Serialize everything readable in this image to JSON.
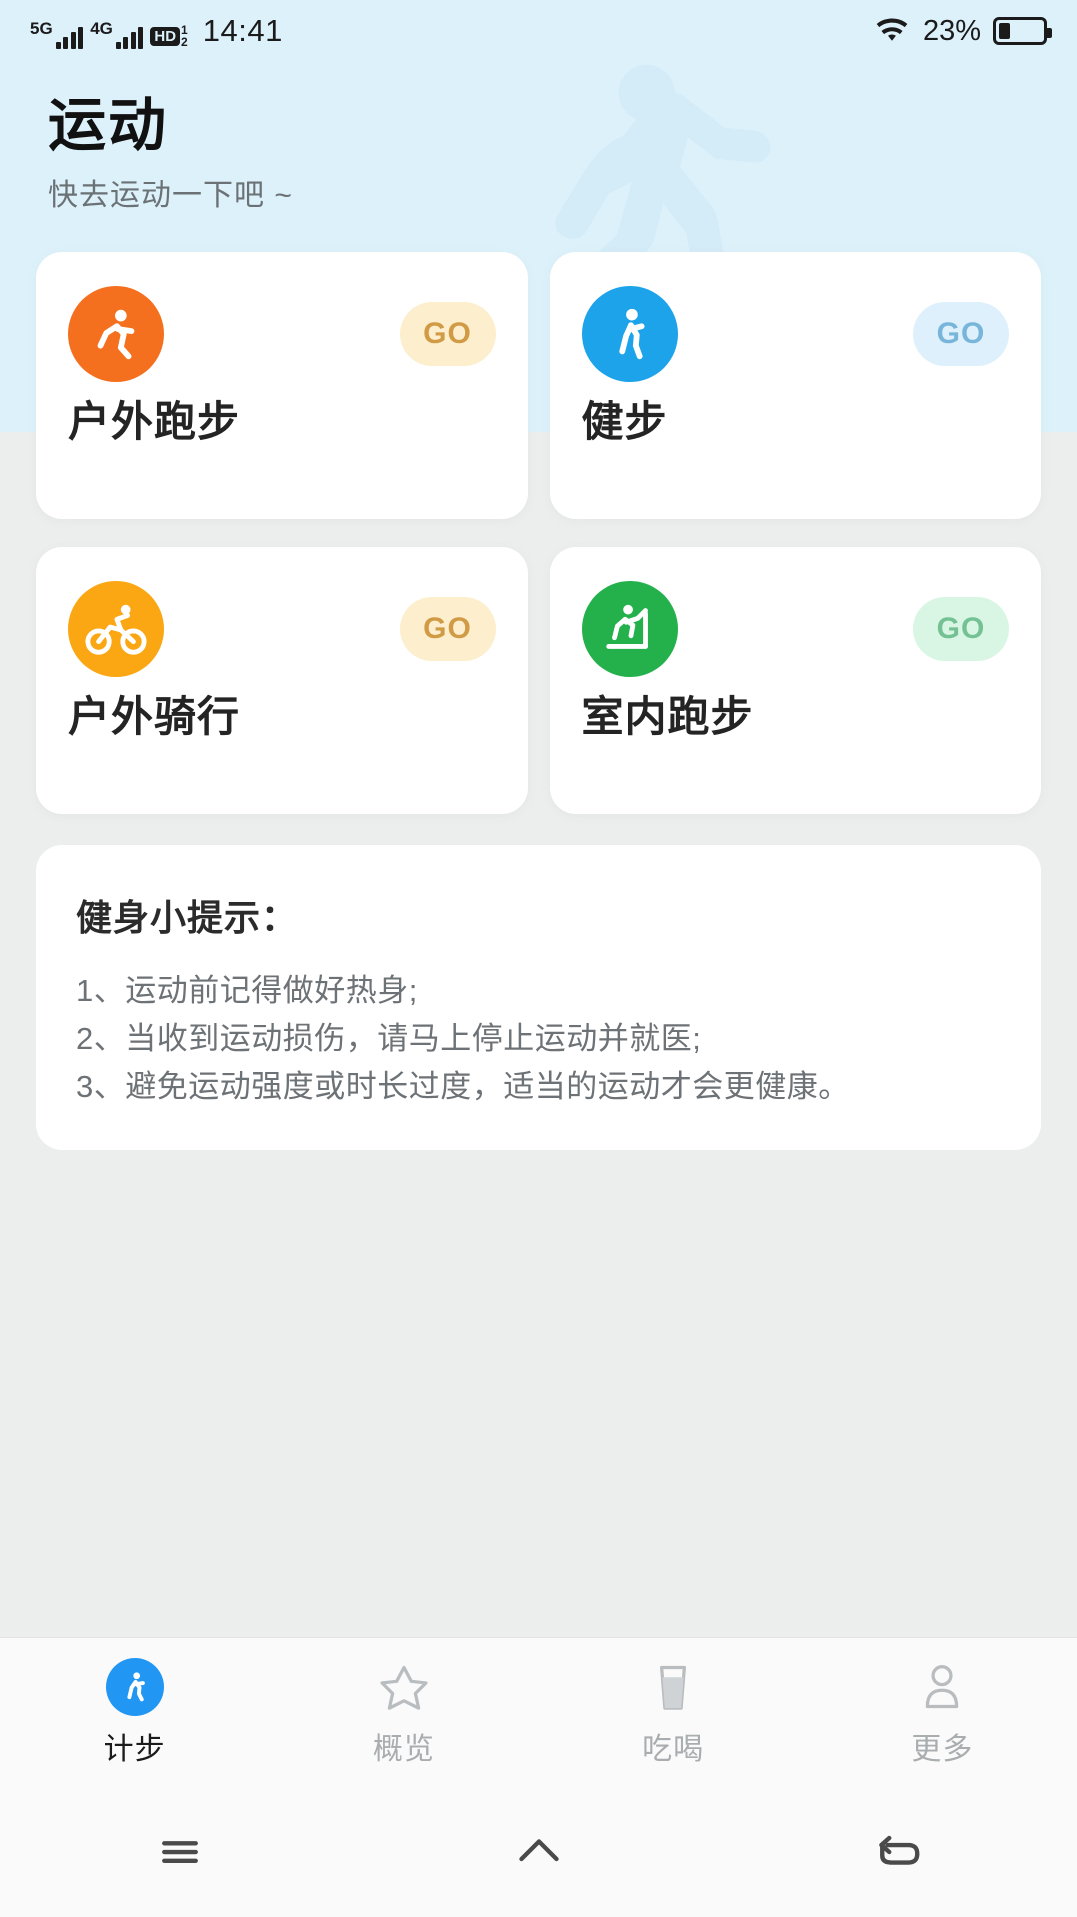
{
  "statusbar": {
    "net1_label": "5G",
    "net2_label": "4G",
    "hd_label": "HD",
    "hd_sup": "1",
    "hd_sub": "2",
    "time": "14:41",
    "battery_percent": "23%",
    "wifi_icon": "wifi-icon",
    "battery_icon": "battery-icon"
  },
  "header": {
    "title": "运动",
    "subtitle": "快去运动一下吧 ~",
    "background_color": "#ddf1fa",
    "watermark_icon": "runner-watermark-icon"
  },
  "activities": [
    {
      "title": "户外跑步",
      "go_label": "GO",
      "icon": "outdoor-running-icon",
      "icon_bg": "#f4701f",
      "badge_bg": "#fdeecd",
      "badge_color": "#d19a45"
    },
    {
      "title": "健步",
      "go_label": "GO",
      "icon": "walking-icon",
      "icon_bg": "#1ca3ea",
      "badge_bg": "#ddf0fb",
      "badge_color": "#77b6da"
    },
    {
      "title": "户外骑行",
      "go_label": "GO",
      "icon": "cycling-icon",
      "icon_bg": "#fba713",
      "badge_bg": "#fdeecd",
      "badge_color": "#d19a45"
    },
    {
      "title": "室内跑步",
      "go_label": "GO",
      "icon": "treadmill-icon",
      "icon_bg": "#24b14c",
      "badge_bg": "#d9f6e4",
      "badge_color": "#74c294"
    }
  ],
  "tips": {
    "title": "健身小提示：",
    "lines": [
      "1、运动前记得做好热身;",
      "2、当收到运动损伤，请马上停止运动并就医;",
      "3、避免运动强度或时长过度，适当的运动才会更健康。"
    ]
  },
  "tabbar": {
    "active_color": "#2196f3",
    "items": [
      {
        "label": "计步",
        "icon": "steps-icon",
        "active": true
      },
      {
        "label": "概览",
        "icon": "star-icon",
        "active": false
      },
      {
        "label": "吃喝",
        "icon": "drink-glass-icon",
        "active": false
      },
      {
        "label": "更多",
        "icon": "person-icon",
        "active": false
      }
    ]
  },
  "navbar": {
    "items": [
      {
        "icon": "menu-icon"
      },
      {
        "icon": "home-icon"
      },
      {
        "icon": "back-icon"
      }
    ]
  }
}
